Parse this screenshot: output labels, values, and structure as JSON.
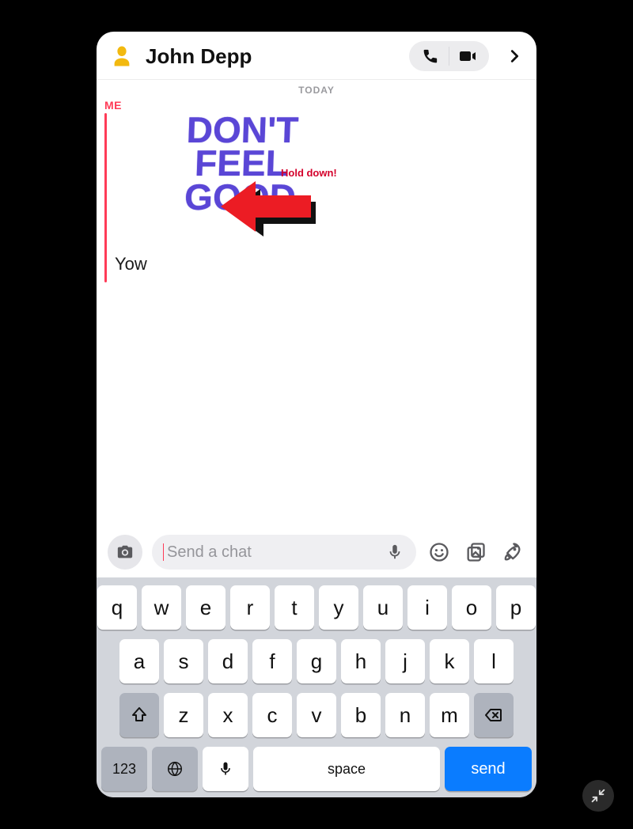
{
  "header": {
    "contact_name": "John Depp"
  },
  "chat": {
    "day_label": "TODAY",
    "sender_label": "ME",
    "sticker_line1": "DON'T",
    "sticker_line2": "FEEL",
    "sticker_line3": "GOOD",
    "annotation": "Hold down!",
    "text_message": "Yow"
  },
  "composer": {
    "placeholder": "Send a chat"
  },
  "keyboard": {
    "row1": [
      "q",
      "w",
      "e",
      "r",
      "t",
      "y",
      "u",
      "i",
      "o",
      "p"
    ],
    "row2": [
      "a",
      "s",
      "d",
      "f",
      "g",
      "h",
      "j",
      "k",
      "l"
    ],
    "row3": [
      "z",
      "x",
      "c",
      "v",
      "b",
      "n",
      "m"
    ],
    "numbers_label": "123",
    "space_label": "space",
    "send_label": "send"
  }
}
